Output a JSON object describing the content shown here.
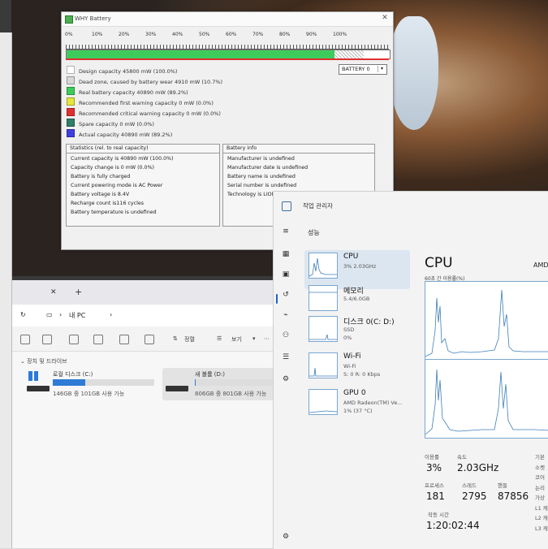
{
  "battery": {
    "title": "WHY Battery",
    "percent_ticks": [
      "0%",
      "10%",
      "20%",
      "30%",
      "40%",
      "50%",
      "60%",
      "70%",
      "80%",
      "90%",
      "100%"
    ],
    "bar": {
      "real_fraction": 0.892,
      "wear_fraction": 0.107
    },
    "legend": [
      {
        "text": "Design capacity 45800 mW (100.0%)",
        "color": "#ffffff"
      },
      {
        "text": "Dead zone, caused by battery wear 4910 mW (10.7%)",
        "color": "#d8d8d8"
      },
      {
        "text": "Real battery capacity 40890 mW (89.2%)",
        "color": "#3dcc5b"
      },
      {
        "text": "Recommended first warning capacity 0 mW (0.0%)",
        "color": "#e6e63a"
      },
      {
        "text": "Recommended critical warning capacity 0 mW (0.0%)",
        "color": "#e03030"
      },
      {
        "text": "Spare capacity 0 mW (0.0%)",
        "color": "#2f7f6a"
      },
      {
        "text": "Actual capacity 40890 mW (89.2%)",
        "color": "#4040e0"
      }
    ],
    "battery_select": "BATTERY 0",
    "statistics": {
      "header": "Statistics (rel. to real capacity)",
      "lines": [
        "Current capacity is 40890 mW (100.0%)",
        "Capacity change is 0 mW (0.0%)",
        "Battery is fully charged",
        "Current powering mode is AC Power",
        "Battery voltage is 8.4V",
        "Recharge count is116 cycles",
        "Battery temperature is undefined"
      ]
    },
    "info": {
      "header": "Battery info",
      "lines": [
        "Manufacturer is undefined",
        "Manufacturer date is undefined",
        "Battery name is undefined",
        "Serial number is undefined",
        "Technology is LION"
      ]
    }
  },
  "explorer": {
    "nav_crumb": "내 PC",
    "toolbar": {
      "sort": "정렬",
      "view": "보기"
    },
    "section": "장치 및 드라이브",
    "drives": [
      {
        "name": "로컬 디스크 (C:)",
        "used_fraction": 0.32,
        "sub": "146GB 중 101GB 사용 가능"
      },
      {
        "name": "새 볼륨 (D:)",
        "used_fraction": 0.01,
        "sub": "806GB 중 801GB 사용 가능"
      }
    ]
  },
  "taskmgr": {
    "title": "작업 관리자",
    "section": "성능",
    "list": [
      {
        "name": "CPU",
        "sub1": "3% 2.03GHz",
        "sub2": ""
      },
      {
        "name": "메모리",
        "sub1": "5.4/6.0GB",
        "sub2": ""
      },
      {
        "name": "디스크 0(C: D:)",
        "sub1": "SSD",
        "sub2": "0%"
      },
      {
        "name": "Wi-Fi",
        "sub1": "Wi-Fi",
        "sub2": "S: 0 R: 0 Kbps"
      },
      {
        "name": "GPU 0",
        "sub1": "AMD Radeon(TM) Ve...",
        "sub2": "1% (37 °C)"
      }
    ],
    "cpu_title": "CPU",
    "cpu_model": "AMD",
    "graph_label": "60초 간 이용률(%)",
    "stats": {
      "util_label": "이용률",
      "util": "3%",
      "speed_label": "속도",
      "speed": "2.03GHz",
      "proc_label": "프로세스",
      "proc": "181",
      "thread_label": "스레드",
      "thread": "2795",
      "handle_label": "핸들",
      "handle": "87856",
      "uptime_label": "작동 시간",
      "uptime": "1:20:02:44"
    },
    "side_labels": [
      "기본",
      "소켓",
      "코어",
      "논리",
      "가상",
      "L1 캐",
      "L2 캐",
      "L3 캐"
    ]
  }
}
